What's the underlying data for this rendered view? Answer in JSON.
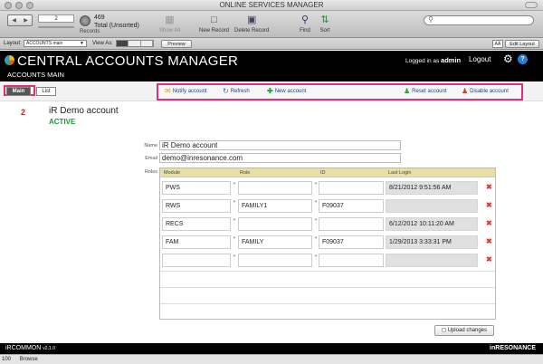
{
  "window": {
    "title": "ONLINE SERVICES MANAGER"
  },
  "toolbar": {
    "record_value": "2",
    "records_label": "Records",
    "found_count": "469",
    "total_label": "Total (Unsorted)",
    "show_all": "Show All",
    "new_record": "New Record",
    "delete_record": "Delete Record",
    "find": "Find",
    "sort": "Sort",
    "search_placeholder": ""
  },
  "layoutbar": {
    "layout_label": "Layout:",
    "layout_value": "ACCOUNTS main",
    "view_as_label": "View As:",
    "preview": "Preview",
    "aa": "AÄ",
    "edit_layout": "Edit Layout"
  },
  "header": {
    "title": "CENTRAL ACCOUNTS MANAGER",
    "subtitle": "ACCOUNTS MAIN",
    "logged_prefix": "Logged in as",
    "user": "admin",
    "logout": "Logout"
  },
  "tabs": {
    "main": "Main",
    "list": "List"
  },
  "actions": {
    "notify": "Notify account",
    "refresh": "Refresh",
    "new_account": "New account",
    "reset": "Reset account",
    "disable": "Disable account"
  },
  "record": {
    "number": "2",
    "name": "iR Demo account",
    "status": "ACTIVE",
    "labels": {
      "name": "Name",
      "email": "Email",
      "roles": "Roles"
    },
    "name_value": "iR Demo account",
    "email_value": "demo@inresonance.com"
  },
  "roles": {
    "headers": {
      "module": "Module",
      "role": "Role",
      "id": "ID",
      "last_login": "Last Login"
    },
    "rows": [
      {
        "module": "PWS",
        "role": "",
        "id": "",
        "last_login": "8/21/2012 9:51:56 AM"
      },
      {
        "module": "RWS",
        "role": "FAMILY1",
        "id": "F09037",
        "last_login": ""
      },
      {
        "module": "RECS",
        "role": "",
        "id": "",
        "last_login": "6/12/2012 10:11:20 AM"
      },
      {
        "module": "FAM",
        "role": "FAMILY",
        "id": "F09037",
        "last_login": "1/29/2013 3:33:31 PM"
      },
      {
        "module": "",
        "role": "",
        "id": "",
        "last_login": ""
      }
    ],
    "upload": "Upload changes"
  },
  "footer": {
    "brand": "iRCOMMON",
    "version": "v2.1.0",
    "right": "inRESONANCE"
  },
  "status": {
    "zoom": "100",
    "mode": "Browse"
  },
  "colors": {
    "highlight": "#e0307a",
    "active": "#1b9a3a",
    "record_number": "#c0212a"
  }
}
